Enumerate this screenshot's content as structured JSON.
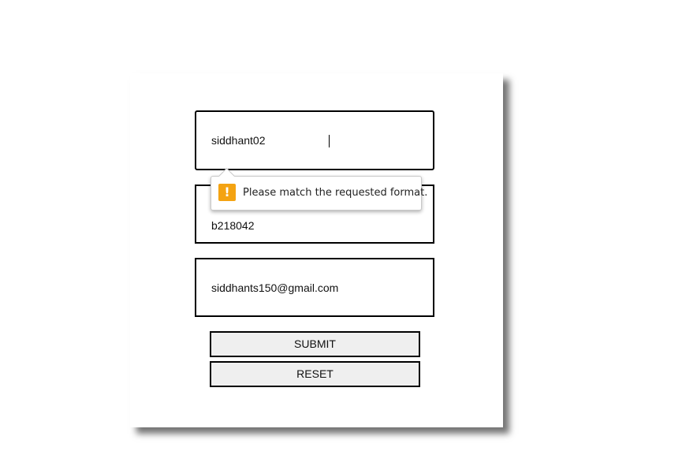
{
  "form": {
    "username": {
      "value": "siddhant02"
    },
    "password": {
      "value": "b218042"
    },
    "email": {
      "value": "siddhants150@gmail.com"
    },
    "submit_label": "SUBMIT",
    "reset_label": "RESET"
  },
  "validation_tooltip": {
    "icon": "warning-icon",
    "icon_glyph": "!",
    "message": "Please match the requested format.",
    "icon_color": "#f4a312"
  }
}
